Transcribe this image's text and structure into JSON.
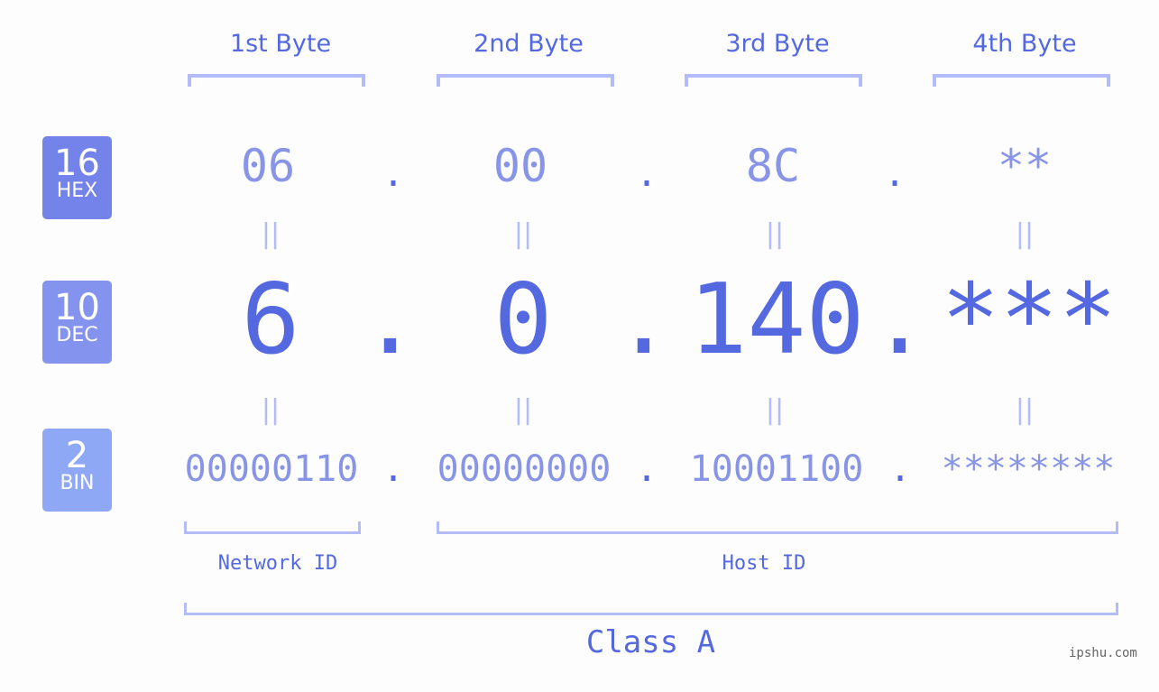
{
  "badges": [
    {
      "num": "16",
      "label": "HEX",
      "color": "#7383ea"
    },
    {
      "num": "10",
      "label": "DEC",
      "color": "#8493ee"
    },
    {
      "num": "2",
      "label": "BIN",
      "color": "#8fa8f5"
    }
  ],
  "byte_headers": [
    "1st Byte",
    "2nd Byte",
    "3rd Byte",
    "4th Byte"
  ],
  "hex": [
    "06",
    "00",
    "8C",
    "**"
  ],
  "dec": [
    "6",
    "0",
    "140",
    "***"
  ],
  "bin": [
    "00000110",
    "00000000",
    "10001100",
    "********"
  ],
  "separator": ".",
  "equals": "||",
  "network_id_label": "Network ID",
  "host_id_label": "Host ID",
  "class_label": "Class A",
  "watermark": "ipshu.com"
}
